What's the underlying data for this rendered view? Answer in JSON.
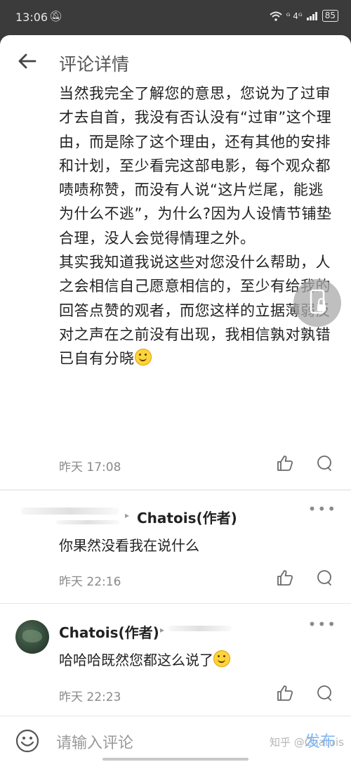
{
  "status_bar": {
    "time": "13:06",
    "signal_text": "ᴳ 4ᴳ",
    "battery": "85"
  },
  "header": {
    "title": "评论详情"
  },
  "main_comment": {
    "text": "当然我完全了解您的意思，您说为了过审才去自首，我没有否认没有“过审”这个理由，而是除了这个理由，还有其他的安排和计划，至少看完这部电影，每个观众都啧啧称赞，而没有人说“这片烂尾，能逃为什么不逃”，为什么?因为人设情节铺垫合理，没人会觉得情理之外。\n其实我知道我说这些对您没什么帮助，人之会相信自己愿意相信的，至少有给我的回答点赞的观者，而您这样的立据薄弱反对之声在之前没有出现，我相信孰对孰错已自有分晓",
    "time": "昨天 17:08"
  },
  "replies": [
    {
      "author": "Chatois(作者)",
      "text": "你果然没看我在说什么",
      "time": "昨天 22:16"
    },
    {
      "author": "Chatois(作者)",
      "text": "哈哈哈既然您都这么说了",
      "time": "昨天 22:23"
    }
  ],
  "input_bar": {
    "placeholder": "请输入评论",
    "send_label": "发布",
    "watermark": "知乎 @Chatois"
  },
  "colors": {
    "send_disabled": "#7fb5f5",
    "meta_gray": "#8a8a8a"
  }
}
